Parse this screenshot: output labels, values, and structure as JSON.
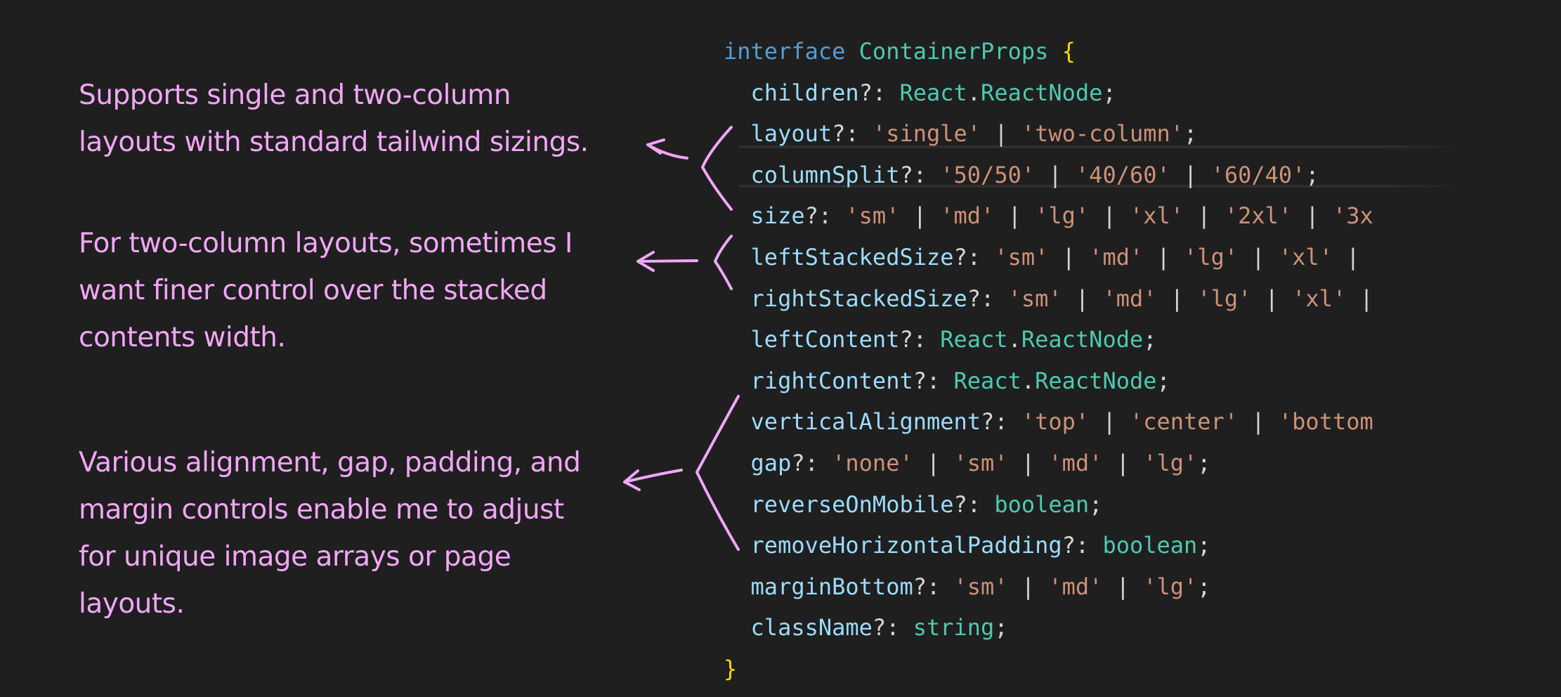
{
  "colors": {
    "background": "#1f1f1f",
    "annotation": "#f2a6f7",
    "keyword": "#569cd6",
    "type": "#4ec9b0",
    "property": "#9cdcfe",
    "string": "#ce9178",
    "brace": "#ffd700"
  },
  "annotations": [
    {
      "lines": [
        "Supports single and two-column",
        "layouts with standard tailwind sizings."
      ]
    },
    {
      "lines": [
        "For two-column layouts, sometimes I",
        "want finer control over the stacked",
        "contents width."
      ]
    },
    {
      "lines": [
        "Various alignment, gap, padding, and",
        "margin controls enable me to adjust",
        "for unique image arrays or page",
        "layouts."
      ]
    }
  ],
  "code": [
    [
      [
        "kw",
        "interface "
      ],
      [
        "ty",
        "ContainerProps "
      ],
      [
        "br",
        "{"
      ]
    ],
    [
      [
        "pu",
        "  "
      ],
      [
        "pr",
        "children"
      ],
      [
        "pu",
        "?: "
      ],
      [
        "ty",
        "React"
      ],
      [
        "pu",
        "."
      ],
      [
        "ty",
        "ReactNode"
      ],
      [
        "pu",
        ";"
      ]
    ],
    [
      [
        "pu",
        "  "
      ],
      [
        "pr",
        "layout"
      ],
      [
        "pu",
        "?: "
      ],
      [
        "st",
        "'single'"
      ],
      [
        "pu",
        " | "
      ],
      [
        "st",
        "'two-column'"
      ],
      [
        "pu",
        ";"
      ]
    ],
    [
      [
        "pu",
        "  "
      ],
      [
        "pr",
        "columnSplit"
      ],
      [
        "pu",
        "?: "
      ],
      [
        "st",
        "'50/50'"
      ],
      [
        "pu",
        " | "
      ],
      [
        "st",
        "'40/60'"
      ],
      [
        "pu",
        " | "
      ],
      [
        "st",
        "'60/40'"
      ],
      [
        "pu",
        ";"
      ]
    ],
    [
      [
        "pu",
        "  "
      ],
      [
        "pr",
        "size"
      ],
      [
        "pu",
        "?: "
      ],
      [
        "st",
        "'sm'"
      ],
      [
        "pu",
        " | "
      ],
      [
        "st",
        "'md'"
      ],
      [
        "pu",
        " | "
      ],
      [
        "st",
        "'lg'"
      ],
      [
        "pu",
        " | "
      ],
      [
        "st",
        "'xl'"
      ],
      [
        "pu",
        " | "
      ],
      [
        "st",
        "'2xl'"
      ],
      [
        "pu",
        " | "
      ],
      [
        "st",
        "'3x"
      ]
    ],
    [
      [
        "pu",
        "  "
      ],
      [
        "pr",
        "leftStackedSize"
      ],
      [
        "pu",
        "?: "
      ],
      [
        "st",
        "'sm'"
      ],
      [
        "pu",
        " | "
      ],
      [
        "st",
        "'md'"
      ],
      [
        "pu",
        " | "
      ],
      [
        "st",
        "'lg'"
      ],
      [
        "pu",
        " | "
      ],
      [
        "st",
        "'xl'"
      ],
      [
        "pu",
        " |"
      ]
    ],
    [
      [
        "pu",
        "  "
      ],
      [
        "pr",
        "rightStackedSize"
      ],
      [
        "pu",
        "?: "
      ],
      [
        "st",
        "'sm'"
      ],
      [
        "pu",
        " | "
      ],
      [
        "st",
        "'md'"
      ],
      [
        "pu",
        " | "
      ],
      [
        "st",
        "'lg'"
      ],
      [
        "pu",
        " | "
      ],
      [
        "st",
        "'xl'"
      ],
      [
        "pu",
        " |"
      ]
    ],
    [
      [
        "pu",
        "  "
      ],
      [
        "pr",
        "leftContent"
      ],
      [
        "pu",
        "?: "
      ],
      [
        "ty",
        "React"
      ],
      [
        "pu",
        "."
      ],
      [
        "ty",
        "ReactNode"
      ],
      [
        "pu",
        ";"
      ]
    ],
    [
      [
        "pu",
        "  "
      ],
      [
        "pr",
        "rightContent"
      ],
      [
        "pu",
        "?: "
      ],
      [
        "ty",
        "React"
      ],
      [
        "pu",
        "."
      ],
      [
        "ty",
        "ReactNode"
      ],
      [
        "pu",
        ";"
      ]
    ],
    [
      [
        "pu",
        "  "
      ],
      [
        "pr",
        "verticalAlignment"
      ],
      [
        "pu",
        "?: "
      ],
      [
        "st",
        "'top'"
      ],
      [
        "pu",
        " | "
      ],
      [
        "st",
        "'center'"
      ],
      [
        "pu",
        " | "
      ],
      [
        "st",
        "'bottom"
      ]
    ],
    [
      [
        "pu",
        "  "
      ],
      [
        "pr",
        "gap"
      ],
      [
        "pu",
        "?: "
      ],
      [
        "st",
        "'none'"
      ],
      [
        "pu",
        " | "
      ],
      [
        "st",
        "'sm'"
      ],
      [
        "pu",
        " | "
      ],
      [
        "st",
        "'md'"
      ],
      [
        "pu",
        " | "
      ],
      [
        "st",
        "'lg'"
      ],
      [
        "pu",
        ";"
      ]
    ],
    [
      [
        "pu",
        "  "
      ],
      [
        "pr",
        "reverseOnMobile"
      ],
      [
        "pu",
        "?: "
      ],
      [
        "ty",
        "boolean"
      ],
      [
        "pu",
        ";"
      ]
    ],
    [
      [
        "pu",
        "  "
      ],
      [
        "pr",
        "removeHorizontalPadding"
      ],
      [
        "pu",
        "?: "
      ],
      [
        "ty",
        "boolean"
      ],
      [
        "pu",
        ";"
      ]
    ],
    [
      [
        "pu",
        "  "
      ],
      [
        "pr",
        "marginBottom"
      ],
      [
        "pu",
        "?: "
      ],
      [
        "st",
        "'sm'"
      ],
      [
        "pu",
        " | "
      ],
      [
        "st",
        "'md'"
      ],
      [
        "pu",
        " | "
      ],
      [
        "st",
        "'lg'"
      ],
      [
        "pu",
        ";"
      ]
    ],
    [
      [
        "pu",
        "  "
      ],
      [
        "pr",
        "className"
      ],
      [
        "pu",
        "?: "
      ],
      [
        "ty",
        "string"
      ],
      [
        "pu",
        ";"
      ]
    ],
    [
      [
        "br",
        "}"
      ]
    ]
  ]
}
